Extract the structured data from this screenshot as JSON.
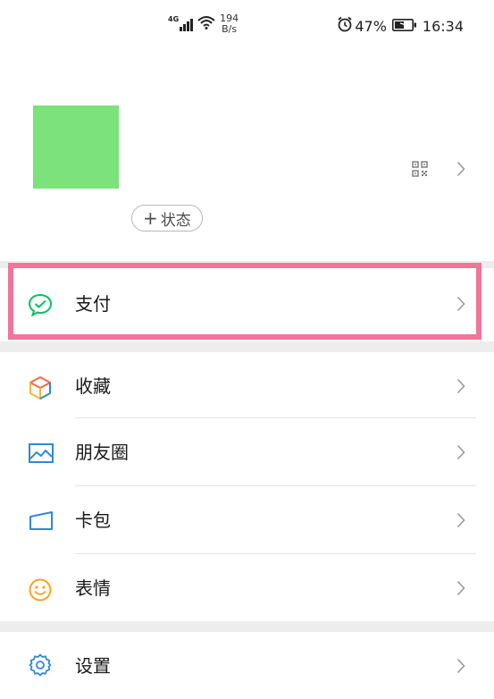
{
  "status_bar": {
    "network": "4G",
    "speed_value": "194",
    "speed_unit": "B/s",
    "battery_percent": "47%",
    "time": "16:34"
  },
  "profile": {
    "avatar_color": "#7ce27c",
    "status_button_label": "状态",
    "status_button_icon": "plus-icon"
  },
  "menu": {
    "pay_label": "支付",
    "favorites_label": "收藏",
    "moments_label": "朋友圈",
    "cards_label": "卡包",
    "stickers_label": "表情",
    "settings_label": "设置"
  },
  "colors": {
    "highlight": "#f07599",
    "pay_icon": "#07c160",
    "moments_icon": "#2f88d6",
    "cards_icon": "#2f88d6",
    "stickers_icon": "#f5a623",
    "settings_icon": "#2f88d6",
    "section_gap": "#ededed"
  }
}
